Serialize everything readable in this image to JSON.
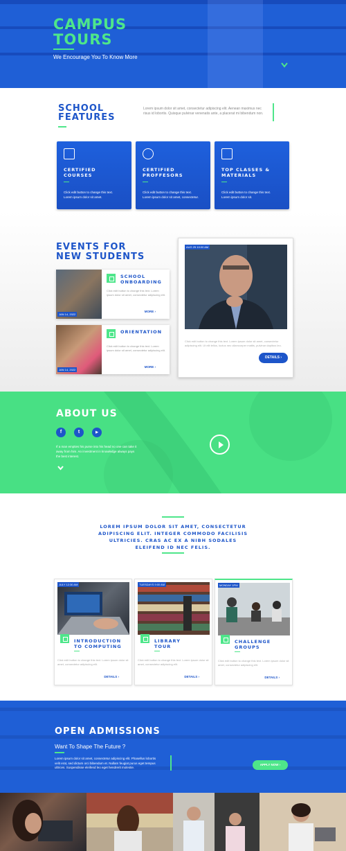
{
  "hero": {
    "title_line1": "CAMPUS",
    "title_line2": "TOURS",
    "subtitle": "We Encourage You To Know More"
  },
  "features": {
    "title_line1": "SCHOOL",
    "title_line2": "FEATURES",
    "description": "Lorem ipsum dolor sit amet, consectetur adipiscing elit. Aenean maximus nec risus id lobortis. Quisque pulvinar venenatis ante, a placerat mi bibendum non.",
    "cards": [
      {
        "icon": "certificate-icon",
        "title_line1": "CERTIFIED",
        "title_line2": "COURSES",
        "desc_line1": "Click edit button to change this text.",
        "desc_line2": "Lorem ipsum dolor sit amet."
      },
      {
        "icon": "professor-icon",
        "title_line1": "CERTIFIED",
        "title_line2": "PROFFESORS",
        "desc_line1": "Click edit button to change this text.",
        "desc_line2": "Lorem ipsum dolor sit amet, consectetur."
      },
      {
        "icon": "classes-icon",
        "title_line1": "TOP CLASSES &",
        "title_line2": "MATERIALS",
        "desc_line1": "Click edit button to change this text.",
        "desc_line2": "Lorem ipsum dolor sit."
      }
    ]
  },
  "events": {
    "title_line1": "EVENTS FOR",
    "title_line2": "NEW STUDENTS",
    "items": [
      {
        "date": "JAN 14, 2022",
        "name_line1": "SCHOOL",
        "name_line2": "ONBOARDING",
        "desc": "Click edit button to change this text. Lorem ipsum dolor sit amet, consectetur adipiscing elit.",
        "more": "MORE ›"
      },
      {
        "date": "JAN 14, 2022",
        "name_line1": "ORIENTATION",
        "name_line2": "",
        "desc": "Click edit button to change this text. Lorem ipsum dolor sit amet, consectetur adipiscing elit.",
        "more": "MORE ›"
      }
    ],
    "featured": {
      "date": "AUG 25 10:00 AM",
      "desc": "Click edit button to change this text. Lorem ipsum dolor sit amet, consectetur adipiscing elit. Ut elit tellus, luctus nec ullamcorper mattis, pulvinar dapibus leo.",
      "button": "DETAILS ›"
    }
  },
  "about": {
    "title": "ABOUT US",
    "social": [
      "f",
      "t",
      "▶"
    ],
    "description": "If a man empties his purse into his head no one can take it away from him. An investment in knowledge always pays the best interest."
  },
  "quote": {
    "text": "LOREM IPSUM DOLOR SIT AMET, CONSECTETUR ADIPISCING ELIT. INTEGER COMMODO FACILISIS ULTRICIES. CRAS AC EX A NIBH SODALES ELEIFEND ID NEC FELIS."
  },
  "tours": [
    {
      "date": "JULY 12:30 AM",
      "name_line1": "INTRODUCTION",
      "name_line2": "TO COMPUTING",
      "desc": "Click edit button to change this text. Lorem ipsum dolor sit amet, consectetur adipiscing elit.",
      "more": "DETAILS ›"
    },
    {
      "date": "TUESDAYS 9:00 AM",
      "name_line1": "LIBRARY",
      "name_line2": "TOUR",
      "desc": "Click edit button to change this text. Lorem ipsum dolor sit amet, consectetur adipiscing elit.",
      "more": "DETAILS ›"
    },
    {
      "date": "MONDAY 1PM",
      "name_line1": "CHALLENGE",
      "name_line2": "GROUPS",
      "desc": "Click edit button to change this text. Lorem ipsum dolor sit amet, consectetur adipiscing elit.",
      "more": "DETAILS ›"
    }
  ],
  "admissions": {
    "title": "OPEN ADMISSIONS",
    "subtitle": "Want To Shape The Future ?",
    "description": "Lorem ipsum dolor sit amet, consectetur adipiscing elit. Phasellus lobortis velit erat, sed dictum orci bibendum et. Nullam feugiat purus eget tempus ultrices. Suspendisse eleifend leo eget hendrerit molestie.",
    "button": "APPLY NOW ›"
  },
  "colors": {
    "primary_blue": "#1d55c9",
    "accent_green": "#4ee68a"
  }
}
